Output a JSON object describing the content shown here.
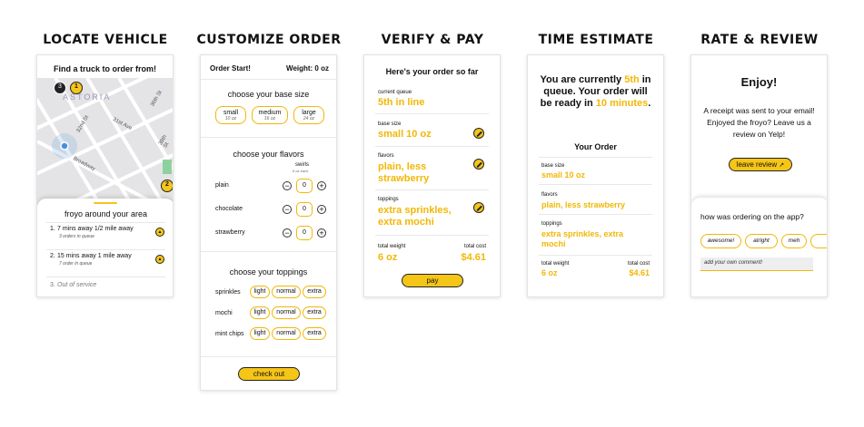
{
  "titles": [
    "LOCATE VEHICLE",
    "CUSTOMIZE ORDER",
    "VERIFY & PAY",
    "TIME ESTIMATE",
    "RATE & REVIEW"
  ],
  "locate": {
    "header": "Find a truck to order from!",
    "map_labels": {
      "area": "ASTORIA",
      "street1": "31st Ave",
      "street2": "32nd St",
      "street3": "36th St",
      "street4": "Broadway",
      "street5": "38th St"
    },
    "markers": [
      "3",
      "1",
      "2"
    ],
    "panel_title": "froyo around your area",
    "trucks": [
      {
        "num": "1.",
        "title": "7 mins away 1/2 mile away",
        "sub": "3 orders in queue"
      },
      {
        "num": "2.",
        "title": "15 mins away 1 mile away",
        "sub": "7 order in queue"
      },
      {
        "num": "3.",
        "title": "Out of service",
        "sub": ""
      }
    ]
  },
  "customize": {
    "header_left": "Order Start!",
    "header_right": "Weight: 0 oz",
    "base_title": "choose your base size",
    "bases": [
      {
        "label": "small",
        "sub": "10 oz"
      },
      {
        "label": "medium",
        "sub": "16 oz"
      },
      {
        "label": "large",
        "sub": "24 oz"
      }
    ],
    "flavors_title": "choose your flavors",
    "swirls_label": "swirls",
    "swirls_sub": "6 oz each",
    "flavors": [
      {
        "name": "plain",
        "qty": "0"
      },
      {
        "name": "chocolate",
        "qty": "0"
      },
      {
        "name": "strawberry",
        "qty": "0"
      }
    ],
    "toppings_title": "choose your toppings",
    "toppings": [
      {
        "name": "sprinkles",
        "opts": [
          "light",
          "normal",
          "extra"
        ]
      },
      {
        "name": "mochi",
        "opts": [
          "light",
          "normal",
          "extra"
        ]
      },
      {
        "name": "mint chips",
        "opts": [
          "light",
          "normal",
          "extra"
        ]
      }
    ],
    "checkout": "check out"
  },
  "verify": {
    "title": "Here's your order so far",
    "queue_label": "current queue",
    "queue_value": "5th in line",
    "base_label": "base size",
    "base_value": "small 10 oz",
    "flavors_label": "flavors",
    "flavors_value": "plain, less strawberry",
    "toppings_label": "toppings",
    "toppings_value": "extra sprinkles, extra mochi",
    "weight_label": "total weight",
    "weight_value": "6 oz",
    "cost_label": "total cost",
    "cost_value": "$4.61",
    "pay": "pay"
  },
  "estimate": {
    "line1": "You are currently",
    "queue": "5th",
    "line2": "in queue. Your order will be ready in",
    "minutes": "10 minutes",
    "period": ".",
    "your_order": "Your Order",
    "base_label": "base size",
    "base_value": "small 10 oz",
    "flavors_label": "flavors",
    "flavors_value": "plain, less strawberry",
    "toppings_label": "toppings",
    "toppings_value": "extra sprinkles, extra mochi",
    "weight_label": "total weight",
    "weight_value": "6 oz",
    "cost_label": "total cost",
    "cost_value": "$4.61"
  },
  "review": {
    "title": "Enjoy!",
    "message": "A receipt was sent to your email! Enjoyed the froyo? Leave us a review on Yelp!",
    "leave_review": "leave review",
    "question": "how was ordering on the app?",
    "chips": [
      "awesome!",
      "alright",
      "meh"
    ],
    "comment_placeholder": "add your own comment!"
  },
  "colors": {
    "accent": "#f5c518",
    "gold_text": "#f2b705",
    "map_bg": "#e4e4e6",
    "map_water": "#4a90d9"
  }
}
